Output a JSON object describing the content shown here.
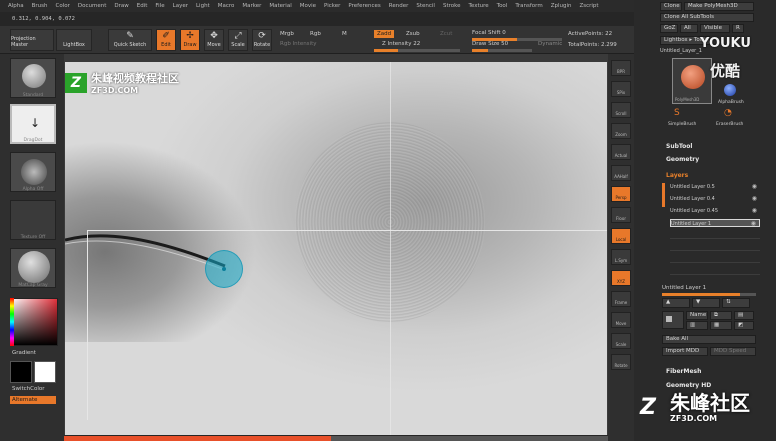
{
  "menubar": {
    "items": [
      "Alpha",
      "Brush",
      "Color",
      "Document",
      "Draw",
      "Edit",
      "File",
      "Layer",
      "Light",
      "Macro",
      "Marker",
      "Material",
      "Movie",
      "Picker",
      "Preferences",
      "Render",
      "Stencil",
      "Stroke",
      "Texture",
      "Tool",
      "Transform",
      "Zplugin",
      "Zscript"
    ]
  },
  "coords": "0.312, 0.904, 0.072",
  "toolbar": {
    "projection_master": "Projection Master",
    "lightbox": "LightBox",
    "quick_sketch": "Quick Sketch",
    "edit": "Edit",
    "draw": "Draw",
    "move": "Move",
    "scale": "Scale",
    "rotate": "Rotate",
    "mrgb": "Mrgb",
    "rgb": "Rgb",
    "m": "M",
    "rgb_intensity": "Rgb Intensity",
    "zadd": "Zadd",
    "zsub": "Zsub",
    "zcut": "Zcut",
    "z_intensity": "Z Intensity 22",
    "focal_shift": "Focal Shift 0",
    "draw_size": "Draw Size 50",
    "dynamic": "Dynamic",
    "active_points": "ActivePoints: 22",
    "total_points": "TotalPoints: 2.299"
  },
  "left": {
    "brush_label": "Standard",
    "stroke_label": "DragDot",
    "alpha_label": "Alpha Off",
    "texture_label": "Texture Off",
    "material_label": "MatCap Gray",
    "gradient": "Gradient",
    "switch_color": "SwitchColor",
    "alternate": "Alternate"
  },
  "watermark": {
    "site_cn": "朱峰视频教程社区",
    "site_en": "ZF3D.COM",
    "corner_cn": "朱峰社区",
    "corner_en": "ZF3D.COM",
    "youku_en": "YOUKU",
    "youku_cn": "优酷"
  },
  "right_tray": [
    "BPR",
    "SPix",
    "Scroll",
    "Zoom",
    "Actual",
    "AAHalf",
    "Persp",
    "Floor",
    "Local",
    "L.Sym",
    "XYZ",
    "Frame",
    "Move",
    "Scale",
    "Rotate"
  ],
  "panel": {
    "clone": "Clone",
    "make_polymesh": "Make PolyMesh3D",
    "clone_all": "Clone All SubTools",
    "goz": "GoZ",
    "all": "All",
    "visible": "Visible",
    "r": "R",
    "lightbox_tools": "Lightbox ▸ Tools",
    "tool_name": "Untitled_Layer_1",
    "tool_thumb": "PolyMesh3D",
    "alpha_brush": "AlphaBrush",
    "simple_brush": "SimpleBrush",
    "eraser_brush": "EraserBrush",
    "subtool": "SubTool",
    "geometry": "Geometry",
    "layers": "Layers",
    "layer_rows": [
      "Untitled Layer 0.5",
      "Untitled Layer 0.4",
      "Untitled Layer 0.45",
      "Untitled Layer 1"
    ],
    "current_layer": "Untitled Layer 1",
    "name": "Name",
    "bake_all": "Bake All",
    "import_mdd": "Import MDD",
    "mdd_speed": "MDD Speed",
    "fibermesh": "FiberMesh",
    "geometry_hd": "Geometry HD"
  },
  "progress": 0.49
}
